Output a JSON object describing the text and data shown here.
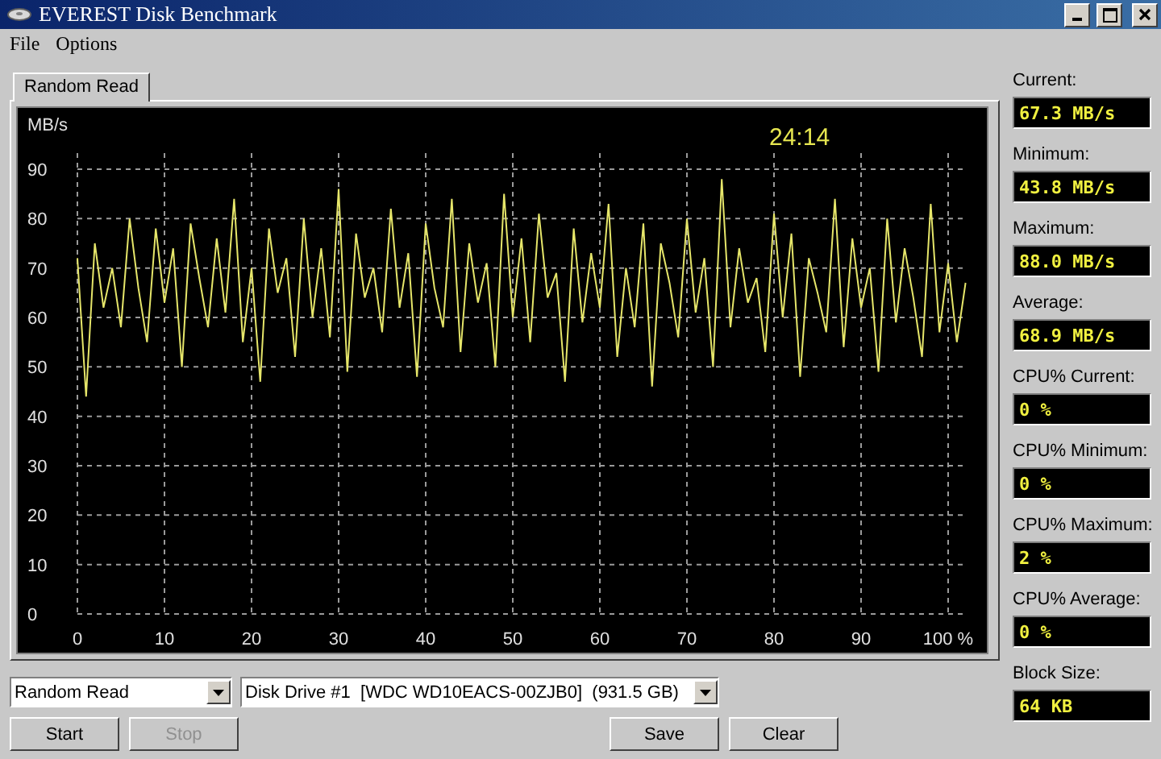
{
  "window": {
    "title": "EVEREST Disk Benchmark"
  },
  "menu": [
    "File",
    "Options"
  ],
  "tabs": [
    {
      "label": "Random Read",
      "selected": true
    }
  ],
  "chart": {
    "elapsed": "24:14",
    "chart_data": {
      "type": "line",
      "ylabel": "MB/s",
      "xlim": [
        0,
        102
      ],
      "ylim": [
        0,
        90
      ],
      "yticks": [
        0,
        10,
        20,
        30,
        40,
        50,
        60,
        70,
        80,
        90
      ],
      "xticks": [
        0,
        10,
        20,
        30,
        40,
        50,
        60,
        70,
        80,
        90,
        {
          "value": 100,
          "label": "100 %"
        }
      ],
      "grid": true,
      "x": [
        0,
        1,
        2,
        3,
        4,
        5,
        6,
        7,
        8,
        9,
        10,
        11,
        12,
        13,
        14,
        15,
        16,
        17,
        18,
        19,
        20,
        21,
        22,
        23,
        24,
        25,
        26,
        27,
        28,
        29,
        30,
        31,
        32,
        33,
        34,
        35,
        36,
        37,
        38,
        39,
        40,
        41,
        42,
        43,
        44,
        45,
        46,
        47,
        48,
        49,
        50,
        51,
        52,
        53,
        54,
        55,
        56,
        57,
        58,
        59,
        60,
        61,
        62,
        63,
        64,
        65,
        66,
        67,
        68,
        69,
        70,
        71,
        72,
        73,
        74,
        75,
        76,
        77,
        78,
        79,
        80,
        81,
        82,
        83,
        84,
        85,
        86,
        87,
        88,
        89,
        90,
        91,
        92,
        93,
        94,
        95,
        96,
        97,
        98,
        99,
        100,
        101,
        102
      ],
      "series": [
        {
          "color": "#e6e66a",
          "values": [
            72,
            44,
            75,
            62,
            70,
            58,
            80,
            66,
            55,
            78,
            63,
            74,
            50,
            79,
            68,
            58,
            76,
            61,
            84,
            55,
            70,
            47,
            78,
            65,
            72,
            52,
            80,
            60,
            74,
            56,
            86,
            49,
            77,
            64,
            70,
            57,
            82,
            62,
            73,
            48,
            79,
            66,
            58,
            84,
            53,
            75,
            63,
            71,
            50,
            85,
            60,
            76,
            55,
            81,
            64,
            69,
            47,
            78,
            59,
            73,
            62,
            83,
            52,
            70,
            58,
            79,
            46,
            75,
            67,
            56,
            80,
            61,
            72,
            50,
            88,
            58,
            74,
            63,
            68,
            53,
            81,
            60,
            77,
            48,
            72,
            65,
            57,
            84,
            54,
            76,
            62,
            70,
            49,
            80,
            59,
            74,
            64,
            52,
            83,
            57,
            71,
            55,
            67
          ]
        }
      ]
    }
  },
  "stats": [
    {
      "label": "Current:",
      "value": "67.3 MB/s"
    },
    {
      "label": "Minimum:",
      "value": "43.8 MB/s"
    },
    {
      "label": "Maximum:",
      "value": "88.0 MB/s"
    },
    {
      "label": "Average:",
      "value": "68.9 MB/s"
    },
    {
      "label": "CPU% Current:",
      "value": "0 %"
    },
    {
      "label": "CPU% Minimum:",
      "value": "0 %"
    },
    {
      "label": "CPU% Maximum:",
      "value": "2 %"
    },
    {
      "label": "CPU% Average:",
      "value": "0 %"
    },
    {
      "label": "Block Size:",
      "value": "64 KB"
    }
  ],
  "test_select": {
    "value": "Random Read"
  },
  "drive_select": {
    "value": "Disk Drive #1  [WDC WD10EACS-00ZJB0]  (931.5 GB)"
  },
  "run_buttons": [
    {
      "label": "Start",
      "disabled": false
    },
    {
      "label": "Stop",
      "disabled": true
    }
  ],
  "file_buttons": [
    {
      "label": "Save",
      "disabled": false
    },
    {
      "label": "Clear",
      "disabled": false
    }
  ]
}
